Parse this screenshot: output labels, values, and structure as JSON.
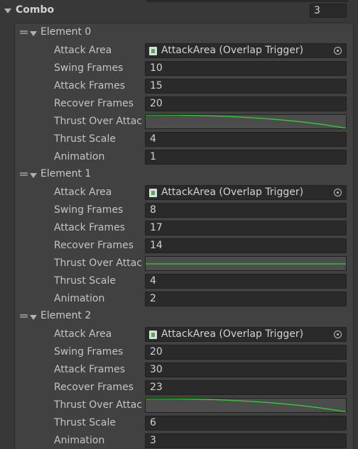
{
  "combo": {
    "label": "Combo",
    "size": "3"
  },
  "labels": {
    "attack_area": "Attack Area",
    "swing_frames": "Swing Frames",
    "attack_frames": "Attack Frames",
    "recover_frames": "Recover Frames",
    "thrust_over_attack": "Thrust Over Attac",
    "thrust_scale": "Thrust Scale",
    "animation": "Animation"
  },
  "elements": [
    {
      "title": "Element 0",
      "attack_area": "AttackArea (Overlap Trigger)",
      "swing_frames": "10",
      "attack_frames": "15",
      "recover_frames": "20",
      "thrust_scale": "4",
      "animation": "1",
      "curve_shape": "ease-down"
    },
    {
      "title": "Element 1",
      "attack_area": "AttackArea (Overlap Trigger)",
      "swing_frames": "8",
      "attack_frames": "17",
      "recover_frames": "14",
      "thrust_scale": "4",
      "animation": "2",
      "curve_shape": "flat"
    },
    {
      "title": "Element 2",
      "attack_area": "AttackArea (Overlap Trigger)",
      "swing_frames": "20",
      "attack_frames": "30",
      "recover_frames": "23",
      "thrust_scale": "6",
      "animation": "3",
      "curve_shape": "ease-down"
    }
  ],
  "colors": {
    "curve": "#2fd12f",
    "panel_bg": "#414141",
    "field_bg": "#2a2a2a"
  }
}
